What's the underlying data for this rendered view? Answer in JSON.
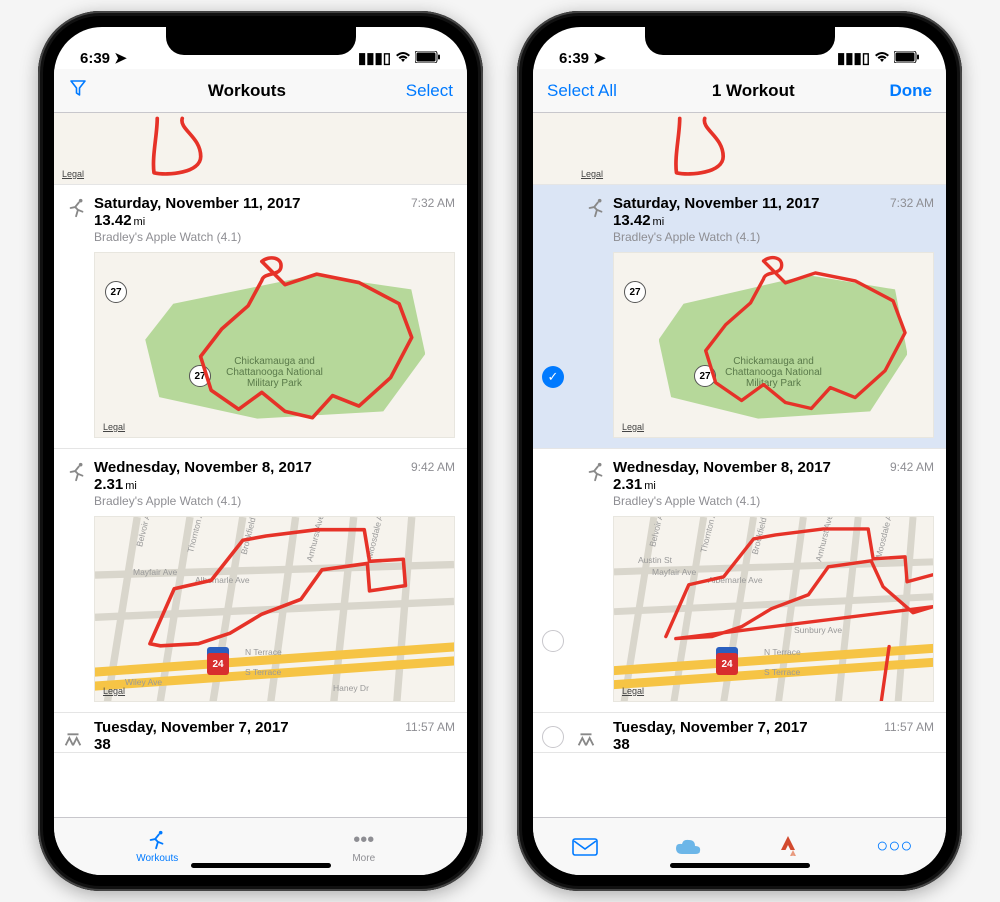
{
  "status_time": "6:39",
  "phones": {
    "left": {
      "nav": {
        "title": "Workouts",
        "right": "Select"
      },
      "tabs": {
        "workouts": "Workouts",
        "more": "More"
      }
    },
    "right": {
      "nav": {
        "left": "Select All",
        "title": "1 Workout",
        "right": "Done"
      }
    }
  },
  "legal": "Legal",
  "workouts": [
    {
      "date": "Saturday, November 11, 2017",
      "distance": "13.42",
      "unit": "mi",
      "time": "7:32 AM",
      "source": "Bradley's Apple Watch (4.1)",
      "park_label": "Chickamauga and Chattanooga National Military Park",
      "shield27": "27"
    },
    {
      "date": "Wednesday, November 8, 2017",
      "distance": "2.31",
      "unit": "mi",
      "time": "9:42 AM",
      "source": "Bradley's Apple Watch (4.1)",
      "i24": "24",
      "roads": {
        "belvoir": "Belvoir Ave",
        "thornton": "Thornton Ave",
        "brookfield": "Brookfield Ave",
        "amhurst": "Amhurst Ave",
        "moosdale": "Moosdale Ave",
        "austin": "Austin St",
        "mayfair": "Mayfair Ave",
        "albemarle": "Albemarle Ave",
        "wiley": "Wiley Ave",
        "sunbury": "Sunbury Ave",
        "haney": "Haney Dr",
        "nterrace": "N Terrace",
        "sterrace": "S Terrace"
      }
    },
    {
      "date": "Tuesday, November 7, 2017",
      "distance_partial": "38",
      "time": "11:57 AM"
    }
  ]
}
